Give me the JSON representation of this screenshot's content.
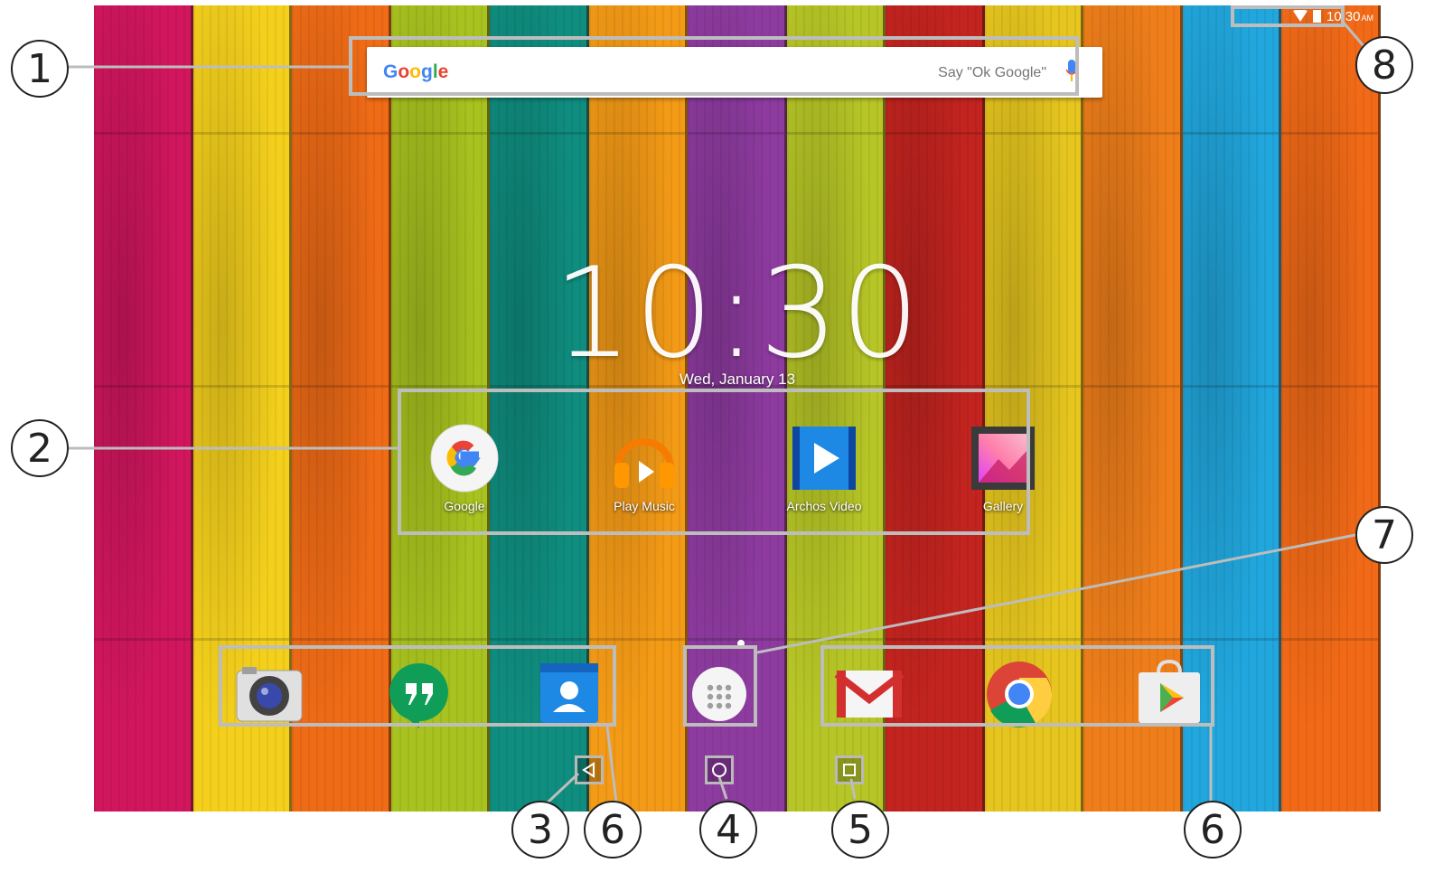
{
  "search": {
    "logo": "Google",
    "hint": "Say \"Ok Google\""
  },
  "status": {
    "time": "10:30",
    "ampm": "AM"
  },
  "clock": {
    "time": "10:30",
    "date": "Wed, January 13"
  },
  "apps": [
    {
      "label": "Google",
      "icon": "google-app-icon"
    },
    {
      "label": "Play Music",
      "icon": "play-music-icon"
    },
    {
      "label": "Archos Video",
      "icon": "archos-video-icon"
    },
    {
      "label": "Gallery",
      "icon": "gallery-icon"
    }
  ],
  "dock": {
    "left": [
      "camera-icon",
      "hangouts-icon",
      "contacts-icon"
    ],
    "center": "app-drawer-icon",
    "right": [
      "gmail-icon",
      "chrome-icon",
      "play-store-icon"
    ]
  },
  "nav": [
    "back-icon",
    "home-icon",
    "recents-icon"
  ],
  "callouts": [
    "1",
    "2",
    "3",
    "6",
    "4",
    "5",
    "6",
    "7",
    "8"
  ],
  "colors": {
    "frame": "#bdbdbd",
    "callout": "#222222"
  }
}
